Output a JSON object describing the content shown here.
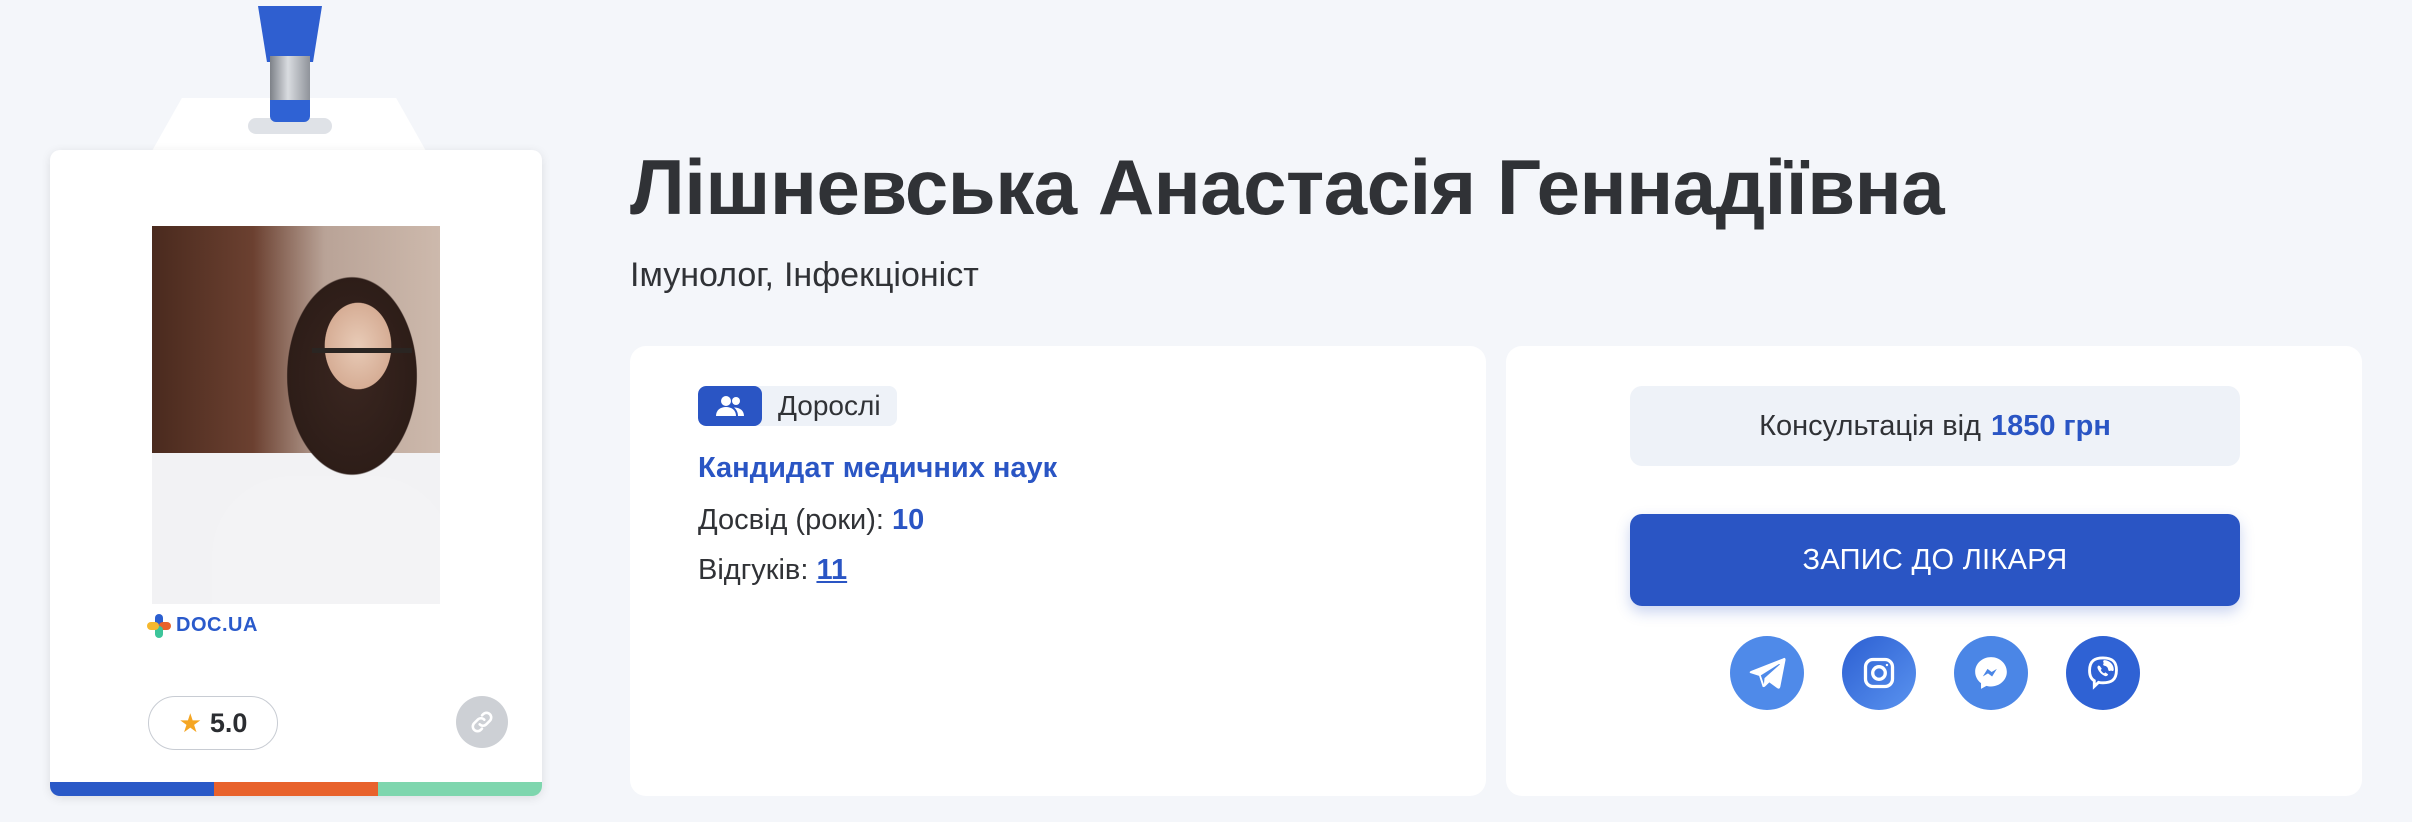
{
  "doctor": {
    "name": "Лішневська Анастасія Геннадіївна",
    "specialties": [
      "Імунолог,",
      "Інфекціоніст"
    ]
  },
  "badge": {
    "logo_text": "DOC.UA",
    "rating": "5.0",
    "stripe_colors": [
      "#2a59c7",
      "#e8622c",
      "#7ed6ae"
    ]
  },
  "info": {
    "age_group": "Дорослі",
    "degree": "Кандидат медичних наук",
    "experience_label": "Досвід (роки):",
    "experience_value": "10",
    "reviews_label": "Відгуків:",
    "reviews_value": "11"
  },
  "booking": {
    "price_label": "Консультація від",
    "price_value": "1850 грн",
    "book_button": "ЗАПИС ДО ЛІКАРЯ",
    "socials": [
      "telegram-icon",
      "instagram-icon",
      "messenger-icon",
      "viber-icon"
    ]
  },
  "colors": {
    "accent": "#2a55c4",
    "background": "#f4f6fa",
    "text": "#303236"
  }
}
